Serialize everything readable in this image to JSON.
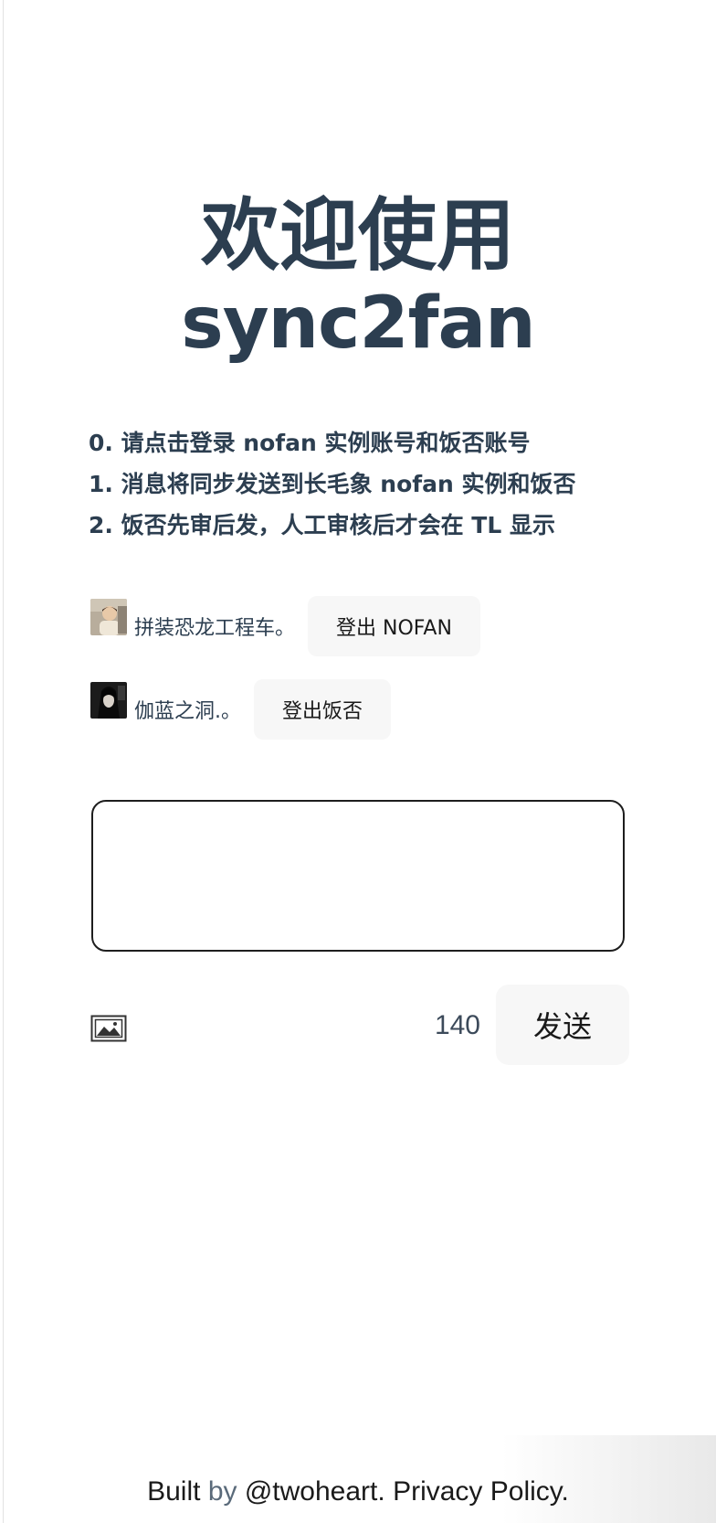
{
  "header": {
    "title_line1": "欢迎使用",
    "title_line2": "sync2fan"
  },
  "instructions": [
    "0. 请点击登录 nofan 实例账号和饭否账号",
    "1. 消息将同步发送到长毛象 nofan 实例和饭否",
    "2. 饭否先审后发，人工审核后才会在 TL 显示"
  ],
  "accounts": [
    {
      "name": "拼装恐龙工程车。",
      "logout_label": "登出 NOFAN",
      "avatar": "child-photo-avatar"
    },
    {
      "name": "伽蓝之洞.。",
      "logout_label": "登出饭否",
      "avatar": "dark-figure-avatar"
    }
  ],
  "composer": {
    "value": "",
    "placeholder": "",
    "remaining_chars": "140",
    "send_label": "发送",
    "image_icon": "image-icon"
  },
  "footer": {
    "built": "Built",
    "by": "by",
    "author": "@twoheart",
    "sep": ".",
    "privacy": "Privacy Policy",
    "end": "."
  },
  "colors": {
    "heading": "#2c3e50",
    "button_bg": "#f7f7f7",
    "textarea_border": "#1e1e1e"
  }
}
